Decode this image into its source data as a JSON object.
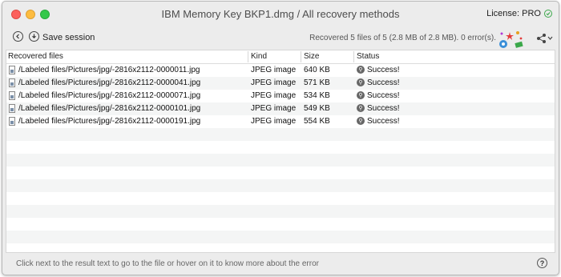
{
  "window": {
    "title": "IBM Memory Key BKP1.dmg / All recovery methods",
    "license_label": "License: PRO"
  },
  "toolbar": {
    "save_label": "Save session",
    "status": "Recovered 5 files of 5 (2.8 MB of 2.8 MB). 0 error(s)."
  },
  "table": {
    "headers": {
      "files": "Recovered files",
      "kind": "Kind",
      "size": "Size",
      "status": "Status"
    },
    "rows": [
      {
        "path": "/Labeled files/Pictures/jpg/-2816x2112-0000011.jpg",
        "kind": "JPEG image",
        "size": "640 KB",
        "status": "Success!"
      },
      {
        "path": "/Labeled files/Pictures/jpg/-2816x2112-0000041.jpg",
        "kind": "JPEG image",
        "size": "571 KB",
        "status": "Success!"
      },
      {
        "path": "/Labeled files/Pictures/jpg/-2816x2112-0000071.jpg",
        "kind": "JPEG image",
        "size": "534 KB",
        "status": "Success!"
      },
      {
        "path": "/Labeled files/Pictures/jpg/-2816x2112-0000101.jpg",
        "kind": "JPEG image",
        "size": "549 KB",
        "status": "Success!"
      },
      {
        "path": "/Labeled files/Pictures/jpg/-2816x2112-0000191.jpg",
        "kind": "JPEG image",
        "size": "554 KB",
        "status": "Success!"
      }
    ]
  },
  "footer": {
    "hint": "Click next to the result text to go to the file or hover on it to know more about the error",
    "help_symbol": "?"
  },
  "icons": {
    "back": "back-arrow-icon",
    "save": "download-icon",
    "share": "share-icon",
    "status": "magnifier-icon",
    "license": "checkmark-icon"
  }
}
